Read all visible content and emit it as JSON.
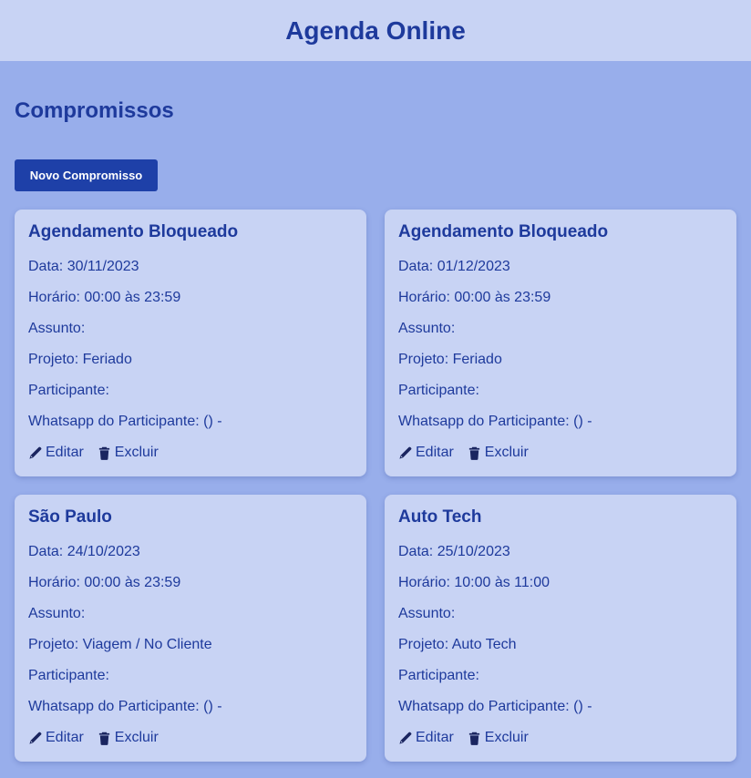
{
  "header": {
    "title": "Agenda Online"
  },
  "main": {
    "section_title": "Compromissos",
    "new_button_label": "Novo Compromisso"
  },
  "labels": {
    "date": "Data:",
    "time": "Horário:",
    "subject": "Assunto:",
    "project": "Projeto:",
    "participant": "Participante:",
    "whatsapp": "Whatsapp do Participante:",
    "edit": "Editar",
    "delete": "Excluir"
  },
  "appointments": [
    {
      "title": "Agendamento Bloqueado",
      "date": "Data: 30/11/2023",
      "time": "Horário: 00:00 às 23:59",
      "subject": "Assunto:",
      "project": "Projeto: Feriado",
      "participant": "Participante:",
      "whatsapp": "Whatsapp do Participante: () -"
    },
    {
      "title": "Agendamento Bloqueado",
      "date": "Data: 01/12/2023",
      "time": "Horário: 00:00 às 23:59",
      "subject": "Assunto:",
      "project": "Projeto: Feriado",
      "participant": "Participante:",
      "whatsapp": "Whatsapp do Participante: () -"
    },
    {
      "title": "São Paulo",
      "date": "Data: 24/10/2023",
      "time": "Horário: 00:00 às 23:59",
      "subject": "Assunto:",
      "project": "Projeto: Viagem / No Cliente",
      "participant": "Participante:",
      "whatsapp": "Whatsapp do Participante: () -"
    },
    {
      "title": "Auto Tech",
      "date": "Data: 25/10/2023",
      "time": "Horário: 10:00 às 11:00",
      "subject": "Assunto:",
      "project": "Projeto: Auto Tech",
      "participant": "Participante:",
      "whatsapp": "Whatsapp do Participante: () -"
    }
  ],
  "icons": {
    "edit": "pencil-icon",
    "delete": "trash-icon"
  },
  "colors": {
    "background": "#98aeeb",
    "header_background": "#c8d3f4",
    "card_background": "#c8d3f4",
    "text": "#1e3a9c",
    "button": "#1e40a8"
  }
}
